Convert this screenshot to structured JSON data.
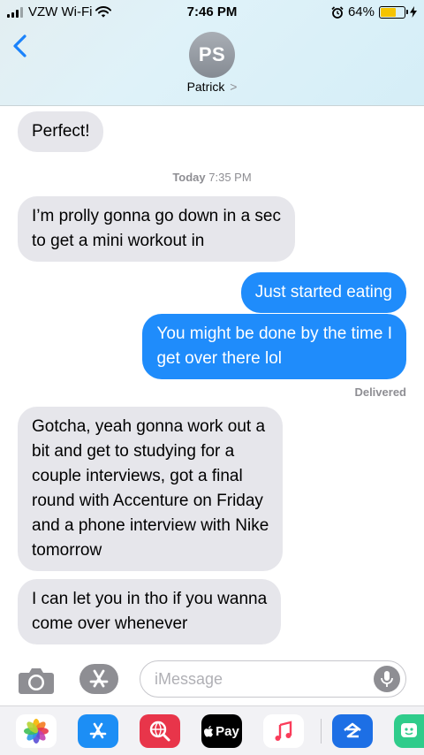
{
  "status_bar": {
    "carrier": "VZW Wi-Fi",
    "time": "7:46 PM",
    "battery": "64%",
    "battery_level": 0.64
  },
  "header": {
    "initials": "PS",
    "contact_name": "Patrick",
    "chevron": ">"
  },
  "messages": [
    {
      "from": "them",
      "lines": [
        "Perfect!"
      ]
    },
    {
      "from": "them",
      "lines": [
        "I’m prolly gonna go down in a sec",
        "to get a mini workout in"
      ]
    },
    {
      "from": "me",
      "lines": [
        "Just started eating"
      ]
    },
    {
      "from": "me",
      "lines": [
        "You might be done by the time I",
        "get over there lol"
      ]
    },
    {
      "from": "them",
      "lines": [
        "Gotcha, yeah gonna work out a",
        "bit and get to studying for a",
        "couple interviews, got a final",
        "round with Accenture on Friday",
        "and a phone interview with Nike",
        "tomorrow"
      ]
    },
    {
      "from": "them",
      "lines": [
        "I can let you in tho if you wanna",
        "come over whenever"
      ]
    }
  ],
  "timestamp": {
    "day": "Today",
    "time": "7:35 PM"
  },
  "delivered": "Delivered",
  "input": {
    "placeholder": "iMessage"
  },
  "app_drawer": {
    "apple_pay_label": "Pay",
    "apps": [
      "photos-app-icon",
      "app-store-icon",
      "images-search-icon",
      "apple-pay-icon",
      "music-icon",
      "zillow-icon",
      "bitmoji-icon"
    ]
  },
  "colors": {
    "sent_bubble": "#1f8cfb",
    "received_bubble": "#e6e6eb",
    "accent": "#1a82fb"
  }
}
